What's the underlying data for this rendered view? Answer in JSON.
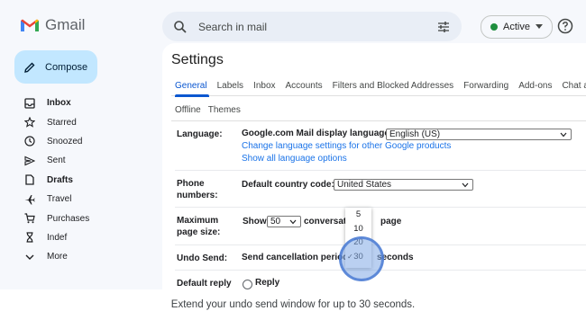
{
  "app": {
    "name": "Gmail",
    "brand_color": "#ea4335"
  },
  "search": {
    "placeholder": "Search in mail"
  },
  "status": {
    "label": "Active",
    "color": "#1e8e3e"
  },
  "compose": {
    "label": "Compose"
  },
  "sidebar": {
    "items": [
      {
        "label": "Inbox",
        "icon": "inbox-icon",
        "bold": true
      },
      {
        "label": "Starred",
        "icon": "star-icon",
        "bold": false
      },
      {
        "label": "Snoozed",
        "icon": "clock-icon",
        "bold": false
      },
      {
        "label": "Sent",
        "icon": "send-icon",
        "bold": false
      },
      {
        "label": "Drafts",
        "icon": "draft-icon",
        "bold": true
      },
      {
        "label": "Travel",
        "icon": "airplane-icon",
        "bold": false
      },
      {
        "label": "Purchases",
        "icon": "cart-icon",
        "bold": false
      },
      {
        "label": "Indef",
        "icon": "hourglass-icon",
        "bold": false
      },
      {
        "label": "More",
        "icon": "chevron-down-icon",
        "bold": false
      }
    ]
  },
  "settings": {
    "title": "Settings",
    "tabs": [
      "General",
      "Labels",
      "Inbox",
      "Accounts",
      "Filters and Blocked Addresses",
      "Forwarding",
      "Add-ons",
      "Chat and"
    ],
    "selected_tab": "General",
    "tabs2": [
      "Offline",
      "Themes"
    ],
    "language": {
      "label": "Language:",
      "display_label": "Google.com Mail display language:",
      "value": "English (US)",
      "link1": "Change language settings for other Google products",
      "link2": "Show all language options"
    },
    "phone": {
      "label": "Phone numbers:",
      "country_label": "Default country code:",
      "value": "United States"
    },
    "page_size": {
      "label": "Maximum page size:",
      "show": "Show",
      "value": "50",
      "suffix_a": "conversat",
      "suffix_b": "page"
    },
    "undo": {
      "label": "Undo Send:",
      "text": "Send cancellation period",
      "suffix": "seconds",
      "options": [
        "5",
        "10",
        "20",
        "30"
      ],
      "selected": "30",
      "check": "✓"
    },
    "reply": {
      "label": "Default reply",
      "option": "Reply"
    }
  },
  "caption": "Extend your undo send window for up to 30 seconds."
}
